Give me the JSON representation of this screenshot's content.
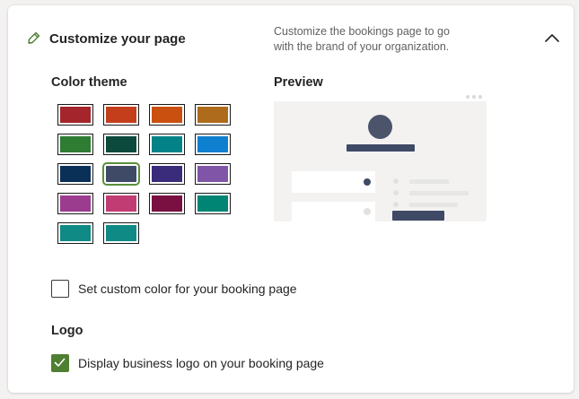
{
  "header": {
    "title": "Customize your page",
    "description": "Customize the bookings page to go with the brand of your organization.",
    "icon": "paintbrush-icon",
    "collapse_icon": "chevron-up-icon"
  },
  "color_theme": {
    "title": "Color theme",
    "selected": "#3e4a66",
    "swatches": [
      "#a4262c",
      "#c43e1c",
      "#ca5010",
      "#ae6b1b",
      "#2e7d32",
      "#0b4a3d",
      "#038387",
      "#0f7fd0",
      "#0b3058",
      "#3e4a66",
      "#3a2c7a",
      "#8055a7",
      "#9b3c8f",
      "#c23c74",
      "#7a1042",
      "#008575",
      "#0f8a85",
      "#0f8a85"
    ]
  },
  "preview": {
    "title": "Preview",
    "accent": "#3f4a66"
  },
  "custom_color": {
    "label": "Set custom color for your booking page",
    "checked": false
  },
  "logo": {
    "title": "Logo",
    "label": "Display business logo on your booking page",
    "checked": true,
    "check_color": "#4f7f32"
  }
}
